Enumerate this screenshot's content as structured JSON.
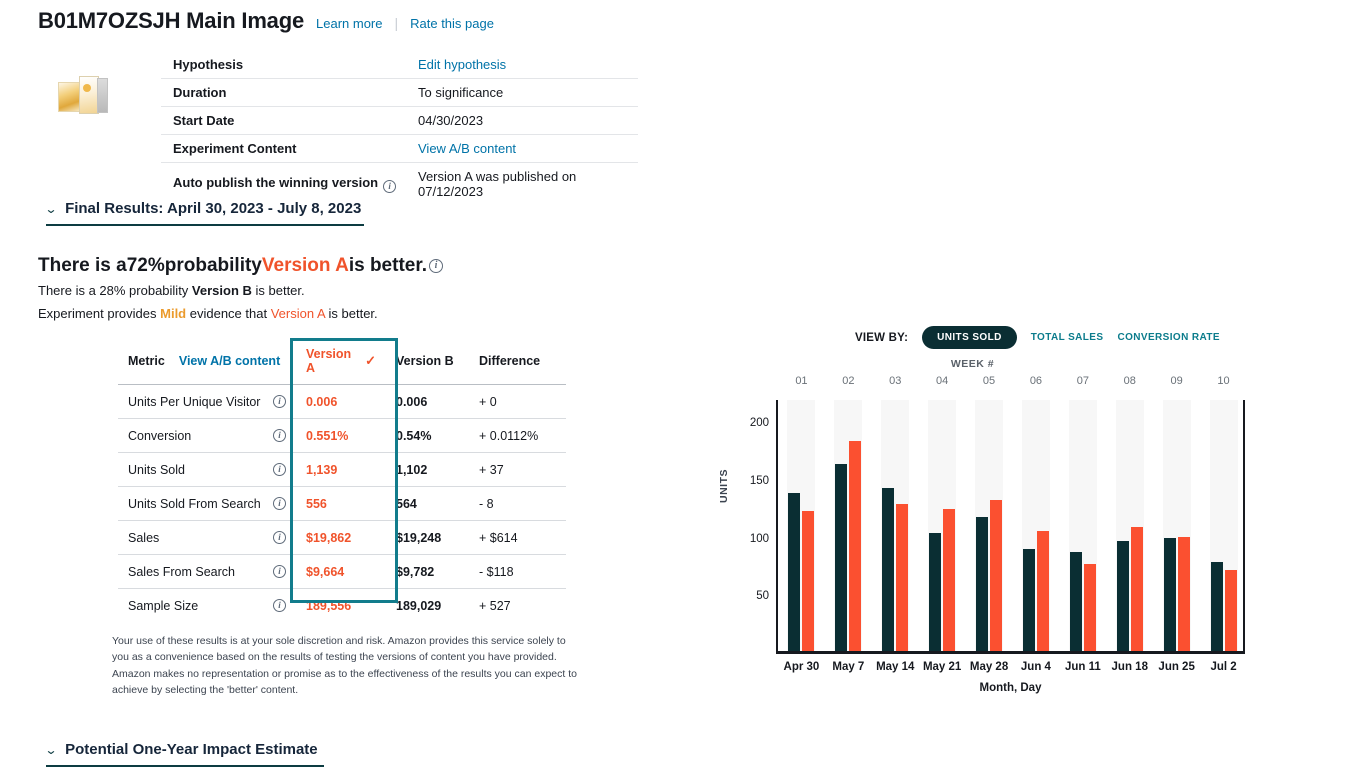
{
  "header": {
    "title": "B01M7OZSJH Main Image",
    "learn_more": "Learn more",
    "separator": "|",
    "rate_page": "Rate this page"
  },
  "info": {
    "rows": [
      {
        "label": "Hypothesis",
        "value": "Edit hypothesis",
        "link": true,
        "info": false
      },
      {
        "label": "Duration",
        "value": "To significance",
        "link": false,
        "info": false
      },
      {
        "label": "Start Date",
        "value": "04/30/2023",
        "link": false,
        "info": false
      },
      {
        "label": "Experiment Content",
        "value": "View A/B content",
        "link": true,
        "info": false
      },
      {
        "label": "Auto publish the winning version",
        "value": "Version A was published on 07/12/2023",
        "link": false,
        "info": true
      }
    ]
  },
  "sections": {
    "final_results": "Final Results: April 30, 2023 - July 8, 2023",
    "impact_estimate": "Potential One-Year Impact Estimate"
  },
  "probability": {
    "lead": "There is a ",
    "percent": "72%",
    "mid": " probability ",
    "winner": "Version A",
    "tail": " is better.",
    "sub_lead": "There is a 28% probability ",
    "sub_bold": "Version B",
    "sub_tail": " is better.",
    "evidence_lead": "Experiment provides ",
    "evidence_level": "Mild",
    "evidence_mid": " evidence that ",
    "evidence_version": "Version A",
    "evidence_tail": " is better."
  },
  "metrics_table": {
    "header": {
      "metric": "Metric",
      "view_ab": "View A/B content",
      "version_a": "Version A",
      "version_a_check": "✓",
      "version_b": "Version B",
      "difference": "Difference"
    },
    "rows": [
      {
        "metric": "Units Per Unique Visitor",
        "a": "0.006",
        "b": "0.006",
        "diff": "+ 0"
      },
      {
        "metric": "Conversion",
        "a": "0.551%",
        "b": "0.54%",
        "diff": "+ 0.0112%"
      },
      {
        "metric": "Units Sold",
        "a": "1,139",
        "b": "1,102",
        "diff": "+ 37"
      },
      {
        "metric": "Units Sold From Search",
        "a": "556",
        "b": "564",
        "diff": "- 8"
      },
      {
        "metric": "Sales",
        "a": "$19,862",
        "b": "$19,248",
        "diff": "+ $614"
      },
      {
        "metric": "Sales From Search",
        "a": "$9,664",
        "b": "$9,782",
        "diff": "- $118"
      },
      {
        "metric": "Sample Size",
        "a": "189,556",
        "b": "189,029",
        "diff": "+ 527"
      }
    ]
  },
  "disclaimer": "Your use of these results is at your sole discretion and risk. Amazon provides this service solely to you as a convenience based on the results of testing the versions of content you have provided. Amazon makes no representation or promise as to the effectiveness of the results you can expect to achieve by selecting the 'better' content.",
  "chart_controls": {
    "view_by_label": "VIEW BY:",
    "options": [
      "UNITS SOLD",
      "TOTAL SALES",
      "CONVERSION RATE"
    ],
    "selected": "UNITS SOLD"
  },
  "chart_data": {
    "type": "bar",
    "title": "",
    "top_axis_label": "WEEK #",
    "xlabel": "Month, Day",
    "ylabel": "UNITS",
    "grid": false,
    "legend_position": "none",
    "ylim": [
      0,
      220
    ],
    "yticks": [
      50,
      100,
      150,
      200
    ],
    "categories": [
      "Apr 30",
      "May 7",
      "May 14",
      "May 21",
      "May 28",
      "Jun 4",
      "Jun 11",
      "Jun 18",
      "Jun 25",
      "Jul 2"
    ],
    "week_numbers": [
      "01",
      "02",
      "03",
      "04",
      "05",
      "06",
      "07",
      "08",
      "09",
      "10"
    ],
    "series": [
      {
        "name": "Version A",
        "color": "#0a2e33",
        "values": [
          137,
          162,
          141,
          102,
          116,
          88,
          86,
          95,
          98,
          77
        ]
      },
      {
        "name": "Version B",
        "color": "#fb5030",
        "values": [
          121,
          182,
          127,
          123,
          131,
          104,
          75,
          107,
          99,
          70
        ]
      }
    ]
  },
  "colors": {
    "accent_version_a": "#f0532b",
    "link": "#0073a8",
    "teal": "#0b7c8c",
    "highlight_border": "#127c8c",
    "dark": "#0a2e33",
    "mild": "#eb9b2d"
  },
  "icons": {
    "info": "i",
    "chevron_down": "⌄",
    "check": "✓"
  }
}
